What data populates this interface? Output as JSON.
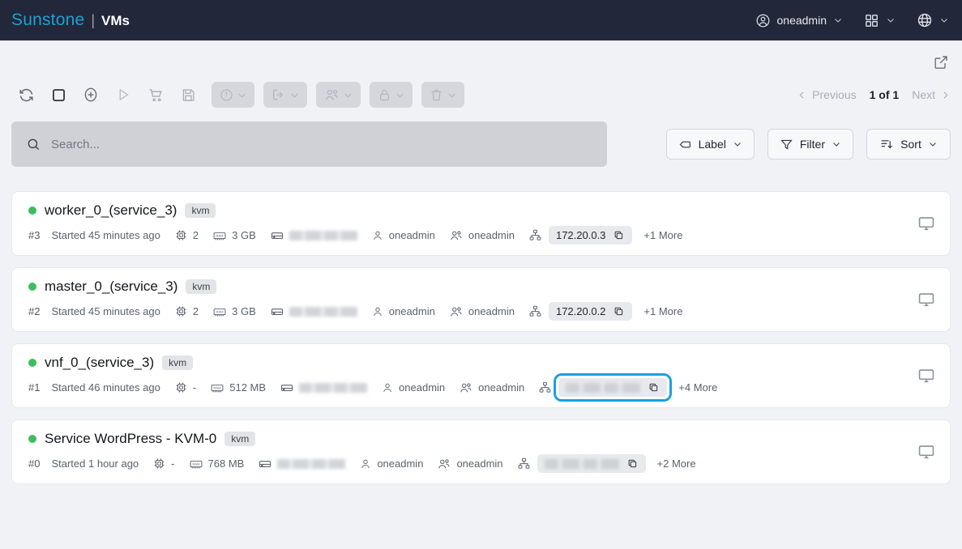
{
  "header": {
    "brand": "Sunstone",
    "separator": "|",
    "section": "VMs",
    "user": "oneadmin",
    "icons": [
      "user-circle-icon",
      "apps-grid-icon",
      "globe-icon"
    ]
  },
  "toolbar": {
    "external_link_icon": "external-link-icon",
    "buttons": [
      {
        "name": "refresh",
        "icon": "refresh-icon",
        "has_chevron": false,
        "grouped": false
      },
      {
        "name": "select-all",
        "icon": "square-icon",
        "has_chevron": false,
        "grouped": false
      },
      {
        "name": "create",
        "icon": "plus-circle-icon",
        "has_chevron": false,
        "grouped": false
      },
      {
        "name": "resume",
        "icon": "play-icon",
        "has_chevron": false,
        "grouped": false
      },
      {
        "name": "deploy",
        "icon": "cart-icon",
        "has_chevron": false,
        "grouped": false
      },
      {
        "name": "save",
        "icon": "floppy-disk-icon",
        "has_chevron": false,
        "grouped": false
      },
      {
        "name": "power",
        "icon": "power-circle-icon",
        "has_chevron": true,
        "grouped": true
      },
      {
        "name": "migrate",
        "icon": "migrate-icon",
        "has_chevron": true,
        "grouped": true
      },
      {
        "name": "ownership",
        "icon": "users-icon",
        "has_chevron": true,
        "grouped": true
      },
      {
        "name": "lock",
        "icon": "lock-icon",
        "has_chevron": true,
        "grouped": true
      },
      {
        "name": "delete",
        "icon": "trash-icon",
        "has_chevron": true,
        "grouped": true
      }
    ]
  },
  "pagination": {
    "previous": "Previous",
    "count": "1 of 1",
    "next": "Next"
  },
  "search": {
    "placeholder": "Search...",
    "value": "",
    "icon": "search-icon"
  },
  "filter_buttons": [
    {
      "label": "Label",
      "icon": "tag-icon"
    },
    {
      "label": "Filter",
      "icon": "funnel-icon"
    },
    {
      "label": "Sort",
      "icon": "sort-icon"
    }
  ],
  "colors": {
    "brand": "#1ea0d4",
    "header_bg": "#22273a",
    "page_bg": "#f1f2f6",
    "status_running": "#3ebd5e",
    "focus_ring": "#1ba0e0"
  },
  "vms": [
    {
      "status": "running",
      "name": "worker_0_(service_3)",
      "hypervisor": "kvm",
      "id": "#3",
      "started": "Started 45 minutes ago",
      "cpu": "2",
      "memory": "3 GB",
      "disk": "",
      "owner": "oneadmin",
      "group": "oneadmin",
      "ip": "172.20.0.3",
      "ip_hidden": false,
      "ip_focused": false,
      "more": "+1 More",
      "vnc_icon": "monitor-icon"
    },
    {
      "status": "running",
      "name": "master_0_(service_3)",
      "hypervisor": "kvm",
      "id": "#2",
      "started": "Started 45 minutes ago",
      "cpu": "2",
      "memory": "3 GB",
      "disk": "",
      "owner": "oneadmin",
      "group": "oneadmin",
      "ip": "172.20.0.2",
      "ip_hidden": false,
      "ip_focused": false,
      "more": "+1 More",
      "vnc_icon": "monitor-icon"
    },
    {
      "status": "running",
      "name": "vnf_0_(service_3)",
      "hypervisor": "kvm",
      "id": "#1",
      "started": "Started 46 minutes ago",
      "cpu": "-",
      "memory": "512 MB",
      "disk": "",
      "owner": "oneadmin",
      "group": "oneadmin",
      "ip": "",
      "ip_hidden": true,
      "ip_focused": true,
      "more": "+4 More",
      "vnc_icon": "monitor-icon"
    },
    {
      "status": "running",
      "name": "Service WordPress - KVM-0",
      "hypervisor": "kvm",
      "id": "#0",
      "started": "Started 1 hour ago",
      "cpu": "-",
      "memory": "768 MB",
      "disk": "",
      "owner": "oneadmin",
      "group": "oneadmin",
      "ip": "",
      "ip_hidden": true,
      "ip_focused": false,
      "more": "+2 More",
      "vnc_icon": "monitor-icon"
    }
  ]
}
